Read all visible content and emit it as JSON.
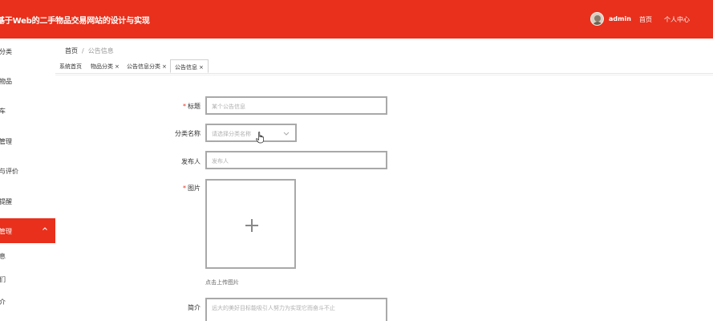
{
  "header": {
    "site_title": "基于Web的二手物品交易网站的设计与实现",
    "username": "admin",
    "nav_home": "首页",
    "nav_center": "个人中心",
    "avatar_icon": "user-avatar-icon",
    "bg_color": "#e8301c"
  },
  "sidebar": {
    "items": [
      {
        "label": "分类"
      },
      {
        "label": "物品"
      },
      {
        "label": "车"
      },
      {
        "label": "管理"
      },
      {
        "label": "与评价"
      },
      {
        "label": "提醒"
      },
      {
        "label": "管理",
        "active": true,
        "icon": "chevron-up-icon"
      },
      {
        "label": "息"
      },
      {
        "label": "们"
      },
      {
        "label": "介"
      }
    ]
  },
  "breadcrumb": {
    "home": "首页",
    "separator": "/",
    "current": "公告信息"
  },
  "tabs": [
    {
      "label": "系统首页"
    },
    {
      "label": "物品分类",
      "close": "×"
    },
    {
      "label": "公告信息分类",
      "close": "×"
    },
    {
      "label": "公告信息",
      "close": "×",
      "active": true
    }
  ],
  "form": {
    "title_label": "标题",
    "title_placeholder": "某个公告信息",
    "category_label": "分类名称",
    "category_placeholder": "请选择分类名称",
    "publisher_label": "发布人",
    "publisher_placeholder": "发布人",
    "image_label": "图片",
    "upload_hint": "点击上传图片",
    "intro_label": "简介",
    "intro_placeholder": "远大的美好目标能吸引人努力为实现它而奋斗不止",
    "required_mark": "*"
  }
}
